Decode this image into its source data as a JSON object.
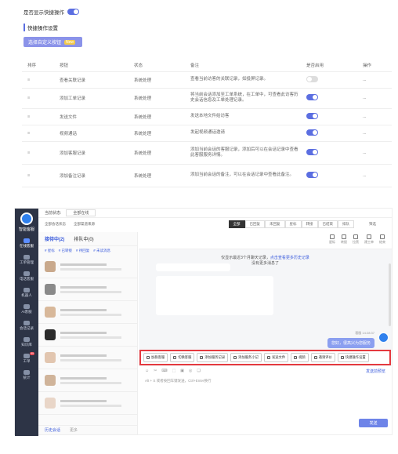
{
  "setting": {
    "label": "是否显示快捷操作",
    "enabled": true
  },
  "section_title": "快捷操作设置",
  "custom_button": {
    "label": "选择自定义按钮",
    "tag": "New"
  },
  "table": {
    "headers": [
      "排序",
      "按钮",
      "状态",
      "备注",
      "是否启用",
      "操作"
    ],
    "rows": [
      {
        "sort": "≡",
        "button": "查看关联记录",
        "status": "系统处理",
        "note": "查看当前访客的关联记录，如投屏记录。",
        "enabled": false,
        "op": "..."
      },
      {
        "sort": "≡",
        "button": "添加工单记录",
        "status": "系统处理",
        "note": "将当前会话添加至工单系统，在工单中，可查看此访客历史会话信息及工单处理记录。",
        "enabled": true,
        "op": "..."
      },
      {
        "sort": "≡",
        "button": "发送文件",
        "status": "系统处理",
        "note": "发送本地文件给访客",
        "enabled": true,
        "op": "..."
      },
      {
        "sort": "≡",
        "button": "视频通话",
        "status": "系统处理",
        "note": "发起视频通话邀请",
        "enabled": true,
        "op": "..."
      },
      {
        "sort": "≡",
        "button": "添加客服记录",
        "status": "系统处理",
        "note": "添加当前会话的客服记录，添加后可以在会话记录中查看此客服服务详情。",
        "enabled": true,
        "op": "..."
      },
      {
        "sort": "≡",
        "button": "添加备注记录",
        "status": "系统处理",
        "note": "添加当前会话的备注，可以在会话记录中查看此备注。",
        "enabled": true,
        "op": "..."
      }
    ]
  },
  "app": {
    "brand": "智能客服",
    "nav": [
      {
        "label": "在线客服",
        "active": true
      },
      {
        "label": "工单管理",
        "active": false
      },
      {
        "label": "电话客服",
        "active": false
      },
      {
        "label": "机器人",
        "active": false
      },
      {
        "label": "AI客服",
        "active": false
      },
      {
        "label": "会话记录",
        "active": false
      },
      {
        "label": "知识库",
        "active": false
      },
      {
        "label": "工单",
        "active": false,
        "badge": "99"
      },
      {
        "label": "统计",
        "active": false
      }
    ],
    "topbar": {
      "status_label": "当前状态:",
      "status_value": "全部在线"
    },
    "filters": {
      "left1": "全部会话状态",
      "left2": "全部渠道来源",
      "tabs": [
        "全部",
        "已回复",
        "未回复",
        "星标",
        "转接",
        "已结束",
        "排队"
      ],
      "more": "筛选"
    },
    "list": {
      "tab_active": "接待中(2)",
      "tab_other": "排队中(0)",
      "sub": [
        "# 星标",
        "# 已转接",
        "# 待回复",
        "# 未读消息"
      ],
      "footer_left": "历史会话",
      "footer_right": "更多"
    },
    "chat": {
      "header_icons": [
        "星标",
        "转接",
        "拉黑",
        "建工单",
        "结束"
      ],
      "history_line1": "仅显示最近3个月聊天记录，",
      "history_link": "点击查看更多历史记录",
      "history_line2": "没有更多消息了",
      "timestamp": "客服 14:28:37",
      "outgoing": "您好，很高兴为您服务",
      "quick_buttons": [
        "加群客服",
        "切换客服",
        "添加服务记录",
        "添加服务小记",
        "发送文件",
        "视频",
        "邀请评价",
        "快捷操作设置"
      ],
      "editor_tools": [
        "☺",
        "✂",
        "⌨",
        "⬚",
        "▣",
        "◎",
        "❑"
      ],
      "editor_check": "发送前预览",
      "hint": "Alt + S 或者按回车键发送，Ctrl+Enter换行",
      "send": "发送"
    }
  }
}
